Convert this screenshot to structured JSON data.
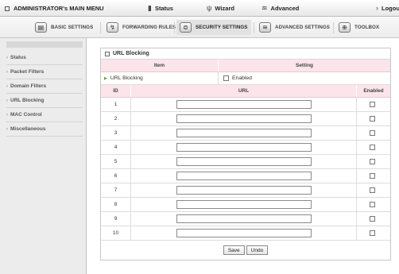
{
  "topbar": {
    "title": "ADMINISTRATOR's MAIN MENU",
    "items": [
      {
        "label": "Status",
        "icon": "status-icon",
        "glyph": "▮"
      },
      {
        "label": "Wizard",
        "icon": "wizard-icon",
        "glyph": "ψ"
      },
      {
        "label": "Advanced",
        "icon": "advanced-icon",
        "glyph": "≋"
      },
      {
        "label": "Logout",
        "glyph": "›"
      }
    ]
  },
  "tabs": [
    {
      "label": "BASIC SETTINGS",
      "icon": "basic-settings-icon",
      "glyph": "▤"
    },
    {
      "label": "FORWARDING RULES",
      "icon": "forwarding-rules-icon",
      "glyph": "↯"
    },
    {
      "label": "SECURITY SETTINGS",
      "icon": "security-settings-icon",
      "glyph": "⊜"
    },
    {
      "label": "ADVANCED SETTINGS",
      "icon": "advanced-settings-icon",
      "glyph": "≋"
    },
    {
      "label": "TOOLBOX",
      "icon": "toolbox-icon",
      "glyph": "⊕"
    }
  ],
  "sidebar": {
    "items": [
      {
        "label": "Status"
      },
      {
        "label": "Packet Filters"
      },
      {
        "label": "Domain Filters"
      },
      {
        "label": "URL Blocking"
      },
      {
        "label": "MAC Control"
      },
      {
        "label": "Miscellaneous"
      }
    ]
  },
  "panel": {
    "title": "URL Blocking",
    "item_header": "Item",
    "setting_header": "Setting",
    "row_label": "URL Blocking",
    "enabled_label": "Enabled",
    "enabled_checked": false
  },
  "table": {
    "headers": {
      "id": "ID",
      "url": "URL",
      "enabled": "Enabled"
    },
    "rows": [
      {
        "id": "1",
        "url": "",
        "enabled": false
      },
      {
        "id": "2",
        "url": "",
        "enabled": false
      },
      {
        "id": "3",
        "url": "",
        "enabled": false
      },
      {
        "id": "4",
        "url": "",
        "enabled": false
      },
      {
        "id": "5",
        "url": "",
        "enabled": false
      },
      {
        "id": "6",
        "url": "",
        "enabled": false
      },
      {
        "id": "7",
        "url": "",
        "enabled": false
      },
      {
        "id": "8",
        "url": "",
        "enabled": false
      },
      {
        "id": "9",
        "url": "",
        "enabled": false
      },
      {
        "id": "10",
        "url": "",
        "enabled": false
      }
    ]
  },
  "buttons": {
    "save": "Save",
    "undo": "Undo"
  },
  "colors": {
    "header_pink": "#fbe5ea",
    "sidebar_bg": "#ececec",
    "accent_green": "#6a9a2a"
  }
}
